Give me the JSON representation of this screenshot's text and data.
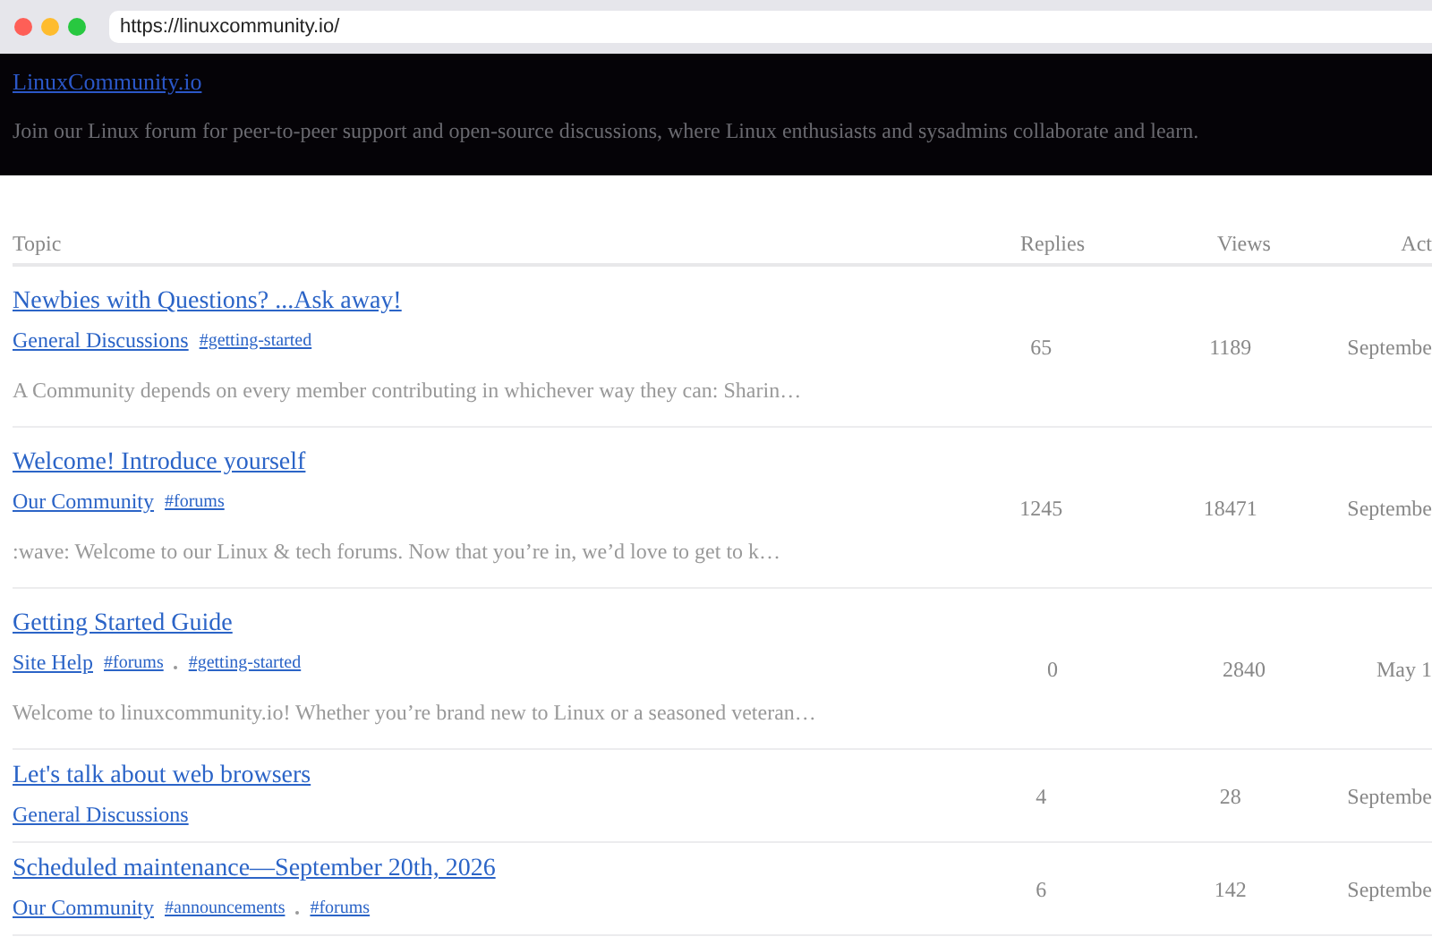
{
  "browser": {
    "url": "https://linuxcommunity.io/"
  },
  "header": {
    "site_link": "LinuxCommunity.io",
    "tagline": "Join our Linux forum for peer-to-peer support and open-source discussions, where Linux enthusiasts and sysadmins collaborate and learn."
  },
  "table": {
    "columns": [
      "Topic",
      "Replies",
      "Views",
      "Act"
    ],
    "rows": [
      {
        "title": "Newbies with Questions? ...Ask away!",
        "category": "General Discussions",
        "tags": [
          "#getting-started"
        ],
        "excerpt": "A Community depends on every member contributing in whichever way they can: Sharin…",
        "replies": "65",
        "views": "1189",
        "activity": "Septembe"
      },
      {
        "title": "Welcome! Introduce yourself",
        "category": "Our Community",
        "tags": [
          "#forums"
        ],
        "excerpt": ":wave: Welcome to our Linux & tech forums. Now that you’re in, we’d love to get to k…",
        "replies": "1245",
        "views": "18471",
        "activity": "Septembe"
      },
      {
        "title": "Getting Started Guide",
        "category": "Site Help",
        "tags": [
          "#forums",
          "#getting-started"
        ],
        "excerpt": "Welcome to linuxcommunity.io! Whether you’re brand new to Linux or a seasoned veteran…",
        "replies": "0",
        "views": "2840",
        "activity": "May 1"
      },
      {
        "title": "Let's talk about web browsers",
        "category": "General Discussions",
        "replies": "4",
        "views": "28",
        "activity": "Septembe"
      },
      {
        "title": "Scheduled maintenance—September 20th, 2026",
        "category": "Our Community",
        "tags": [
          "#announcements",
          "#forums"
        ],
        "replies": "6",
        "views": "142",
        "activity": "Septembe"
      }
    ]
  }
}
